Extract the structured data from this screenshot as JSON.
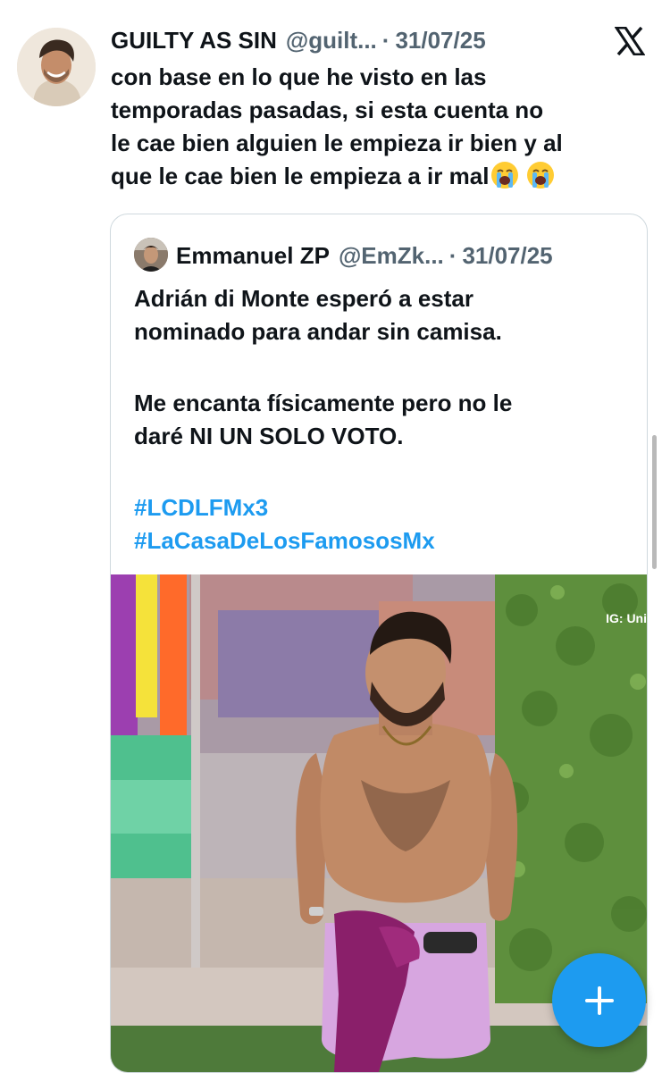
{
  "tweet": {
    "author_name": "GUILTY AS SIN",
    "author_handle": "@guilt...",
    "separator": "·",
    "date": "31/07/25",
    "text_lines": [
      "con base en lo que he visto en las",
      "temporadas pasadas, si esta cuenta no",
      "le cae bien alguien le empieza ir bien y al",
      "que le cae bien le empieza a ir mal"
    ],
    "emoji_names": [
      "loudly-crying-face",
      "loudly-crying-face"
    ]
  },
  "quoted_tweet": {
    "author_name": "Emmanuel ZP",
    "author_handle": "@EmZk...",
    "separator": "·",
    "date": "31/07/25",
    "text_lines": [
      "Adrián di Monte esperó a estar",
      "nominado para andar sin camisa.",
      "Me encanta físicamente pero no le",
      "daré NI UN SOLO VOTO."
    ],
    "hashtags": [
      "#LCDLFMx3",
      "#LaCasaDeLosFamososMx"
    ],
    "media_watermark": "IG: Uni"
  },
  "icons": {
    "close": "x-logo-icon",
    "compose": "plus-icon"
  },
  "colors": {
    "link": "#1d9bf0",
    "fab": "#1d9bf0",
    "secondary_text": "#536471",
    "border": "#cfd9de"
  }
}
